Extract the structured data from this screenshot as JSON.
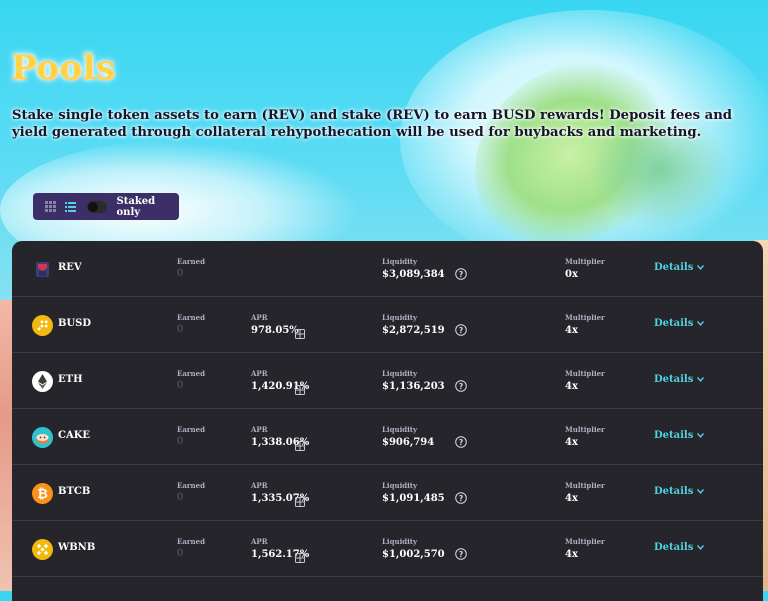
{
  "page": {
    "title": "Pools",
    "subtitle": "Stake single token assets to earn (REV) and stake (REV) to earn BUSD rewards! Deposit fees and yield generated through collateral rehypothecation will be used for buybacks and marketing."
  },
  "toolbar": {
    "grid_icon": "grid-view-icon",
    "list_icon": "list-view-icon",
    "staked_only_label": "Staked only",
    "staked_only_on": false
  },
  "labels": {
    "earned": "Earned",
    "apr": "APR",
    "liquidity": "Liquidity",
    "multiplier": "Multiplier",
    "details": "Details"
  },
  "colors": {
    "title": "#ffd24a",
    "panel": "#26252b",
    "toolbar": "#3c2f67",
    "details_link": "#4fd3e0"
  },
  "pools": [
    {
      "token": "REV",
      "icon": "rev-token-icon",
      "earned": "0",
      "apr": "",
      "liquidity": "$3,089,384",
      "multiplier": "0x"
    },
    {
      "token": "BUSD",
      "icon": "busd-token-icon",
      "earned": "0",
      "apr": "978.05%",
      "liquidity": "$2,872,519",
      "multiplier": "4x"
    },
    {
      "token": "ETH",
      "icon": "eth-token-icon",
      "earned": "0",
      "apr": "1,420.91%",
      "liquidity": "$1,136,203",
      "multiplier": "4x"
    },
    {
      "token": "CAKE",
      "icon": "cake-token-icon",
      "earned": "0",
      "apr": "1,338.06%",
      "liquidity": "$906,794",
      "multiplier": "4x"
    },
    {
      "token": "BTCB",
      "icon": "btcb-token-icon",
      "earned": "0",
      "apr": "1,335.07%",
      "liquidity": "$1,091,485",
      "multiplier": "4x"
    },
    {
      "token": "WBNB",
      "icon": "wbnb-token-icon",
      "earned": "0",
      "apr": "1,562.17%",
      "liquidity": "$1,002,570",
      "multiplier": "4x"
    }
  ]
}
